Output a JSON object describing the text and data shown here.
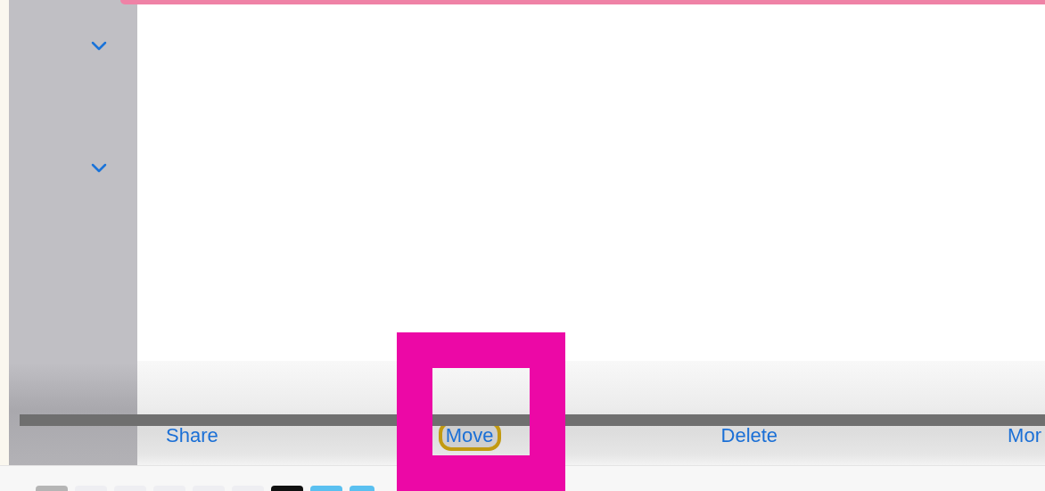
{
  "toolbar": {
    "buttons": [
      {
        "label": "Share",
        "highlighted": false
      },
      {
        "label": "Move",
        "highlighted": true
      },
      {
        "label": "Delete",
        "highlighted": false
      },
      {
        "label": "Mor",
        "highlighted": false
      }
    ]
  }
}
